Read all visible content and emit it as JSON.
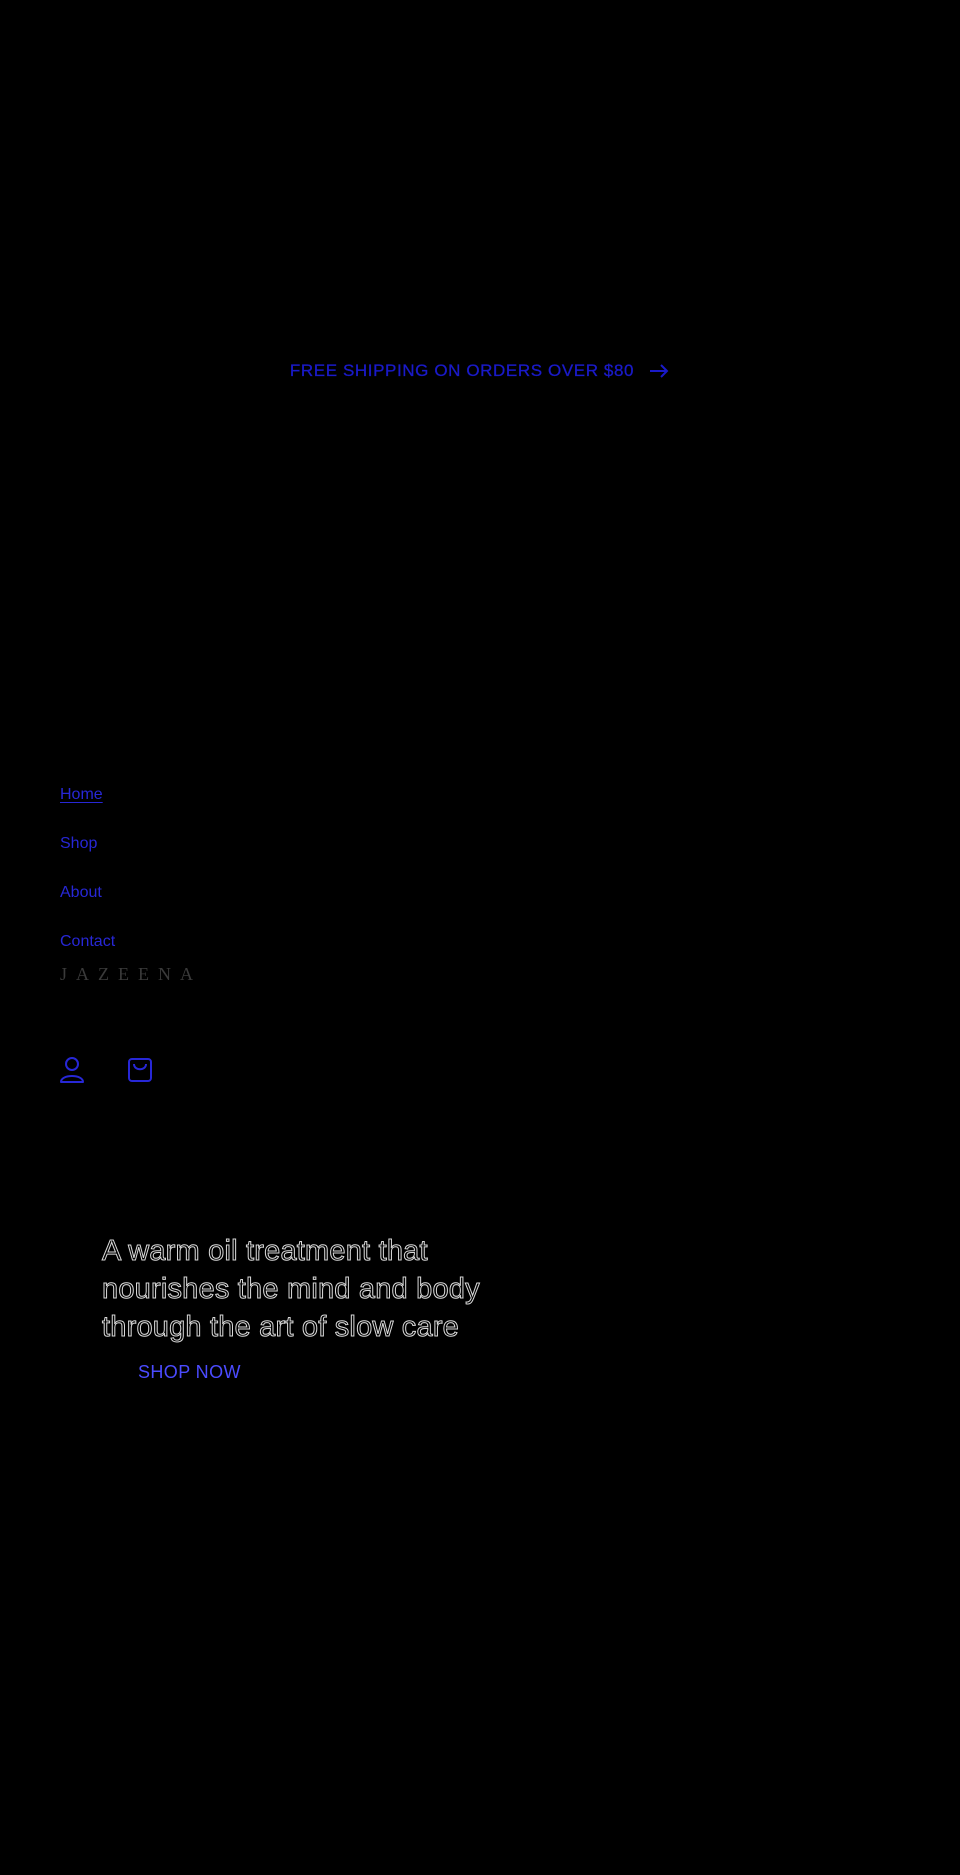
{
  "announcement": {
    "text": "FREE SHIPPING ON ORDERS OVER $80",
    "arrow_icon": "arrow-right-icon"
  },
  "nav": {
    "items": [
      {
        "label": "Home",
        "active": true
      },
      {
        "label": "Shop",
        "active": false
      },
      {
        "label": "About",
        "active": false
      },
      {
        "label": "Contact",
        "active": false
      }
    ]
  },
  "brand": {
    "logo_text": "JAZEENA"
  },
  "header_icons": {
    "account_icon": "user-icon",
    "cart_icon": "shopping-bag-icon"
  },
  "hero": {
    "heading_lines": [
      "A warm oil treatment that",
      "nourishes the mind and body",
      "through the art of slow care"
    ],
    "cta_label": "SHOP NOW"
  },
  "colors": {
    "background": "#000000",
    "link": "#2727d6",
    "cta": "#4b4bff",
    "logo": "#3a3a3a"
  }
}
